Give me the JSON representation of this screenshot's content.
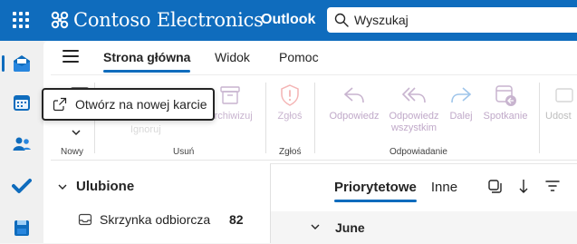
{
  "header": {
    "brand": "Contoso Electronics",
    "app_name": "Outlook",
    "search_placeholder": "Wyszukaj"
  },
  "tabs": [
    "Strona główna",
    "Widok",
    "Pomoc"
  ],
  "ribbon": {
    "groups": [
      "Nowy",
      "Usuń",
      "Zgłoś",
      "Odpowiadanie"
    ],
    "buttons": {
      "ignore": "Ignoruj",
      "archive": "Archiwizuj",
      "report": "Zgłoś",
      "reply": "Odpowiedz",
      "reply_all_line1": "Odpowiedz",
      "reply_all_line2": "wszystkim",
      "forward": "Dalej",
      "meeting": "Spotkanie",
      "share": "Udost"
    }
  },
  "tooltip": {
    "text": "Otwórz na nowej karcie"
  },
  "folders": {
    "favorites_title": "Ulubione",
    "inbox_label": "Skrzynka odbiorcza",
    "inbox_count": "82"
  },
  "message_list": {
    "focused_tab": "Priorytetowe",
    "other_tab": "Inne",
    "group_title": "June"
  },
  "colors": {
    "accent": "#0f6cbd",
    "disabled_purple": "#c8b4cf"
  }
}
